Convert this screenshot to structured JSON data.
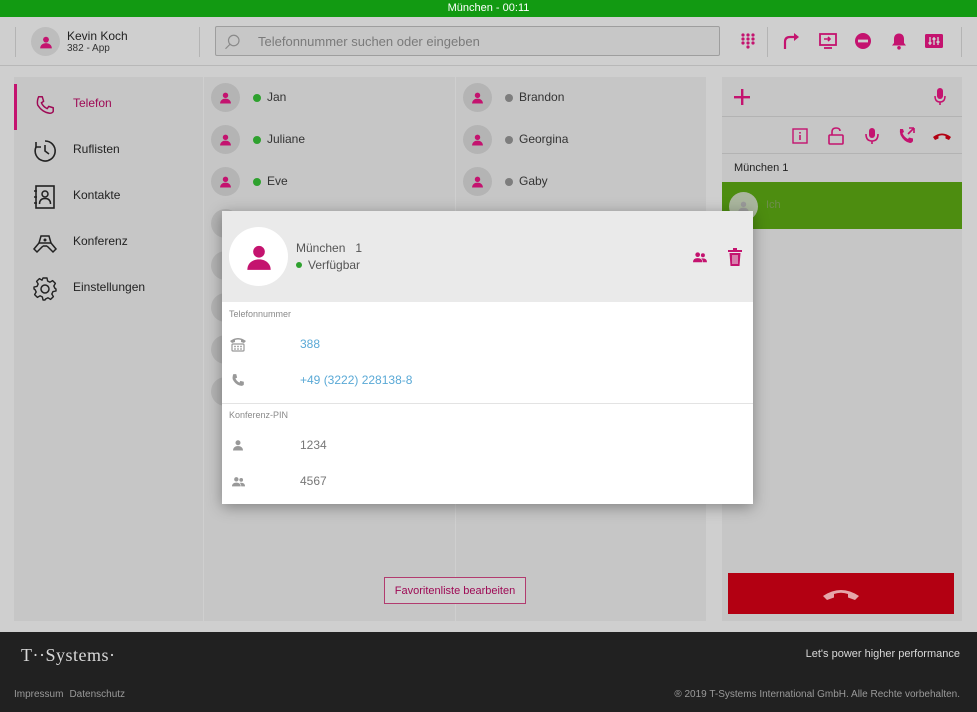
{
  "topbar": {
    "title": "München - 00:11"
  },
  "header": {
    "user_name": "Kevin Koch",
    "user_ext": "382 - App",
    "search_placeholder": "Telefonnummer suchen oder eingeben",
    "icons": [
      "dialpad-icon",
      "forward-icon",
      "screen-share-icon",
      "dnd-icon",
      "bell-icon",
      "equalizer-icon"
    ]
  },
  "sidebar": {
    "items": [
      {
        "label": "Telefon",
        "icon": "phone-icon",
        "active": true
      },
      {
        "label": "Ruflisten",
        "icon": "history-icon"
      },
      {
        "label": "Kontakte",
        "icon": "contacts-icon"
      },
      {
        "label": "Konferenz",
        "icon": "conference-icon"
      },
      {
        "label": "Einstellungen",
        "icon": "gear-icon"
      }
    ]
  },
  "favorites": {
    "col1": [
      {
        "name": "Jan",
        "status": "available"
      },
      {
        "name": "Juliane",
        "status": "available"
      },
      {
        "name": "Eve",
        "status": "available"
      }
    ],
    "col2": [
      {
        "name": "Brandon",
        "status": "offline"
      },
      {
        "name": "Georgina",
        "status": "offline"
      },
      {
        "name": "Gaby",
        "status": "offline"
      }
    ],
    "edit_label": "Favoritenliste bearbeiten"
  },
  "conference_panel": {
    "room_name": "München 1",
    "participant": "Ich",
    "colors": {
      "active_row": "#4d8d10",
      "hangup": "#b30012"
    }
  },
  "modal": {
    "name": "München",
    "number_suffix": "1",
    "status": "Verfügbar",
    "phone_section": "Telefonnummer",
    "ext": "388",
    "phone": "+49 (3222) 228138-8",
    "pin_section": "Konferenz-PIN",
    "pin_user": "1234",
    "pin_group": "4567"
  },
  "footer": {
    "logo": "T··Systems·",
    "slogan": "Let's power higher performance",
    "links": [
      "Impressum",
      "Datenschutz"
    ],
    "copyright": "® 2019 T-Systems International GmbH. Alle Rechte vorbehalten."
  },
  "colors": {
    "accent": "#c4136f",
    "topbar": "#129a12",
    "available": "#2ea12e",
    "offline": "#7d7d7d"
  }
}
